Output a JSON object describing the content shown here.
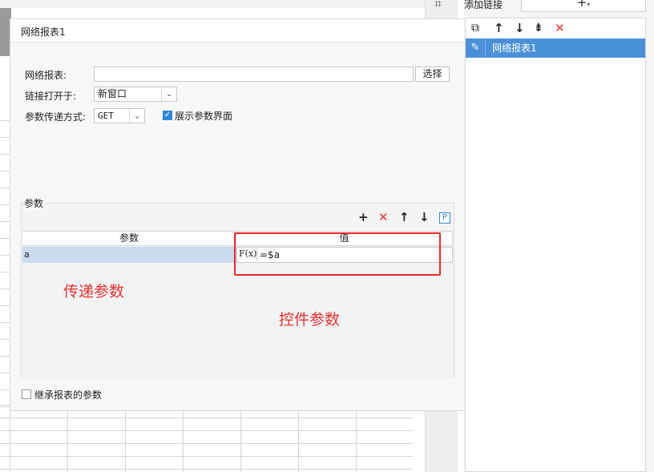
{
  "dialog": {
    "tab_title": "网络报表1",
    "report_label": "网络报表:",
    "report_value": "",
    "select_button": "选择",
    "open_label": "链接打开于:",
    "open_value": "新窗口",
    "method_label": "参数传递方式:",
    "method_value": "GET",
    "show_params_label": "展示参数界面",
    "show_params_checked": true
  },
  "params": {
    "group_title": "参数",
    "columns": [
      "参数",
      "值"
    ],
    "rows": [
      {
        "param": "a",
        "value": "=$a"
      }
    ],
    "fx_label": "F(x)",
    "p_button": "P"
  },
  "inherit_label": "继承报表的参数",
  "inherit_checked": false,
  "annotations": {
    "pass_params": "传递参数",
    "control_params": "控件参数",
    "color": "#e8322f"
  },
  "right_panel": {
    "add_link_label": "添加链接",
    "add_button": "+",
    "links": [
      "网络报表1"
    ]
  },
  "colors": {
    "accent": "#2d88d6",
    "selected_row": "#4a90d9",
    "param_row": "#c9dbec",
    "delete_red": "#e8322f"
  }
}
